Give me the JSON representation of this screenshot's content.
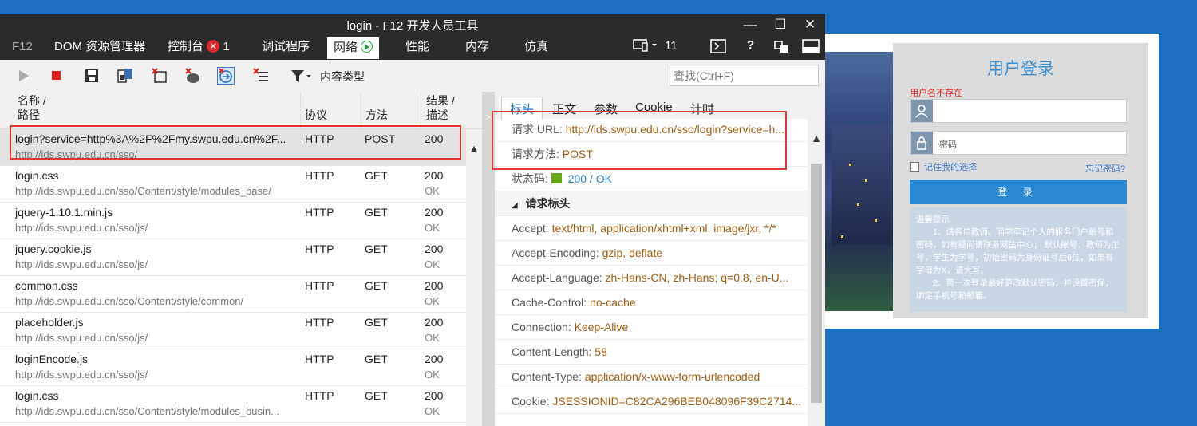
{
  "window": {
    "title": "login - F12 开发人员工具",
    "minimize": "—",
    "maximize": "☐",
    "close": "✕"
  },
  "tabs": {
    "f12": "F12",
    "dom": "DOM 资源管理器",
    "console": "控制台",
    "console_errors": "1",
    "debugger": "调试程序",
    "network": "网络",
    "performance": "性能",
    "memory": "内存",
    "emulation": "仿真",
    "device_count": "11"
  },
  "toolbar": {
    "content_type": "内容类型",
    "search_placeholder": "查找(Ctrl+F)"
  },
  "columns": {
    "name": "名称 /",
    "path": "路径",
    "protocol": "协议",
    "method": "方法",
    "result": "结果 /",
    "description": "描述"
  },
  "requests": [
    {
      "name": "login?service=http%3A%2F%2Fmy.swpu.edu.cn%2F...",
      "path": "http://ids.swpu.edu.cn/sso/",
      "protocol": "HTTP",
      "method": "POST",
      "status": "200",
      "desc": ""
    },
    {
      "name": "login.css",
      "path": "http://ids.swpu.edu.cn/sso/Content/style/modules_base/",
      "protocol": "HTTP",
      "method": "GET",
      "status": "200",
      "desc": "OK"
    },
    {
      "name": "jquery-1.10.1.min.js",
      "path": "http://ids.swpu.edu.cn/sso/js/",
      "protocol": "HTTP",
      "method": "GET",
      "status": "200",
      "desc": "OK"
    },
    {
      "name": "jquery.cookie.js",
      "path": "http://ids.swpu.edu.cn/sso/js/",
      "protocol": "HTTP",
      "method": "GET",
      "status": "200",
      "desc": "OK"
    },
    {
      "name": "common.css",
      "path": "http://ids.swpu.edu.cn/sso/Content/style/common/",
      "protocol": "HTTP",
      "method": "GET",
      "status": "200",
      "desc": "OK"
    },
    {
      "name": "placeholder.js",
      "path": "http://ids.swpu.edu.cn/sso/js/",
      "protocol": "HTTP",
      "method": "GET",
      "status": "200",
      "desc": "OK"
    },
    {
      "name": "loginEncode.js",
      "path": "http://ids.swpu.edu.cn/sso/js/",
      "protocol": "HTTP",
      "method": "GET",
      "status": "200",
      "desc": "OK"
    },
    {
      "name": "login.css",
      "path": "http://ids.swpu.edu.cn/sso/Content/style/modules_busin...",
      "protocol": "HTTP",
      "method": "GET",
      "status": "200",
      "desc": "OK"
    }
  ],
  "detail_tabs": [
    "标头",
    "正文",
    "参数",
    "Cookie",
    "计时"
  ],
  "detail": {
    "url_key": "请求 URL:",
    "url_val": "http://ids.swpu.edu.cn/sso/login?service=h...",
    "method_key": "请求方法:",
    "method_val": "POST",
    "status_key": "状态码:",
    "status_val": "200 / OK",
    "section": "请求标头",
    "headers": [
      {
        "k": "Accept:",
        "v": "text/html, application/xhtml+xml, image/jxr, */*"
      },
      {
        "k": "Accept-Encoding:",
        "v": "gzip, deflate"
      },
      {
        "k": "Accept-Language:",
        "v": "zh-Hans-CN, zh-Hans; q=0.8, en-U..."
      },
      {
        "k": "Cache-Control:",
        "v": "no-cache"
      },
      {
        "k": "Connection:",
        "v": "Keep-Alive"
      },
      {
        "k": "Content-Length:",
        "v": "58"
      },
      {
        "k": "Content-Type:",
        "v": "application/x-www-form-urlencoded"
      },
      {
        "k": "Cookie:",
        "v": "JSESSIONID=C82CA296BEB048096F39C2714..."
      }
    ]
  },
  "login": {
    "title": "用户登录",
    "error": "用户名不存在",
    "password_placeholder": "密码",
    "remember": "记住我的选择",
    "forgot": "忘记密码?",
    "button": "登 录",
    "notice_title": "温馨提示",
    "notice_1": "1、请各位教师、同学牢记个人的服务门户账号和密码，如有疑问请联系网信中心； 默认账号：教师为工号，学生为学号，初始密码为身份证号后6位，如果有字母为X，请大写。",
    "notice_2": "2、第一次登录最好更改默认密码，并设置密保，绑定手机号和邮箱。"
  },
  "colors": {
    "accent": "#1c6ec6",
    "error": "#e23434",
    "value": "#a15c10",
    "desktop": "#1d6fbf"
  }
}
